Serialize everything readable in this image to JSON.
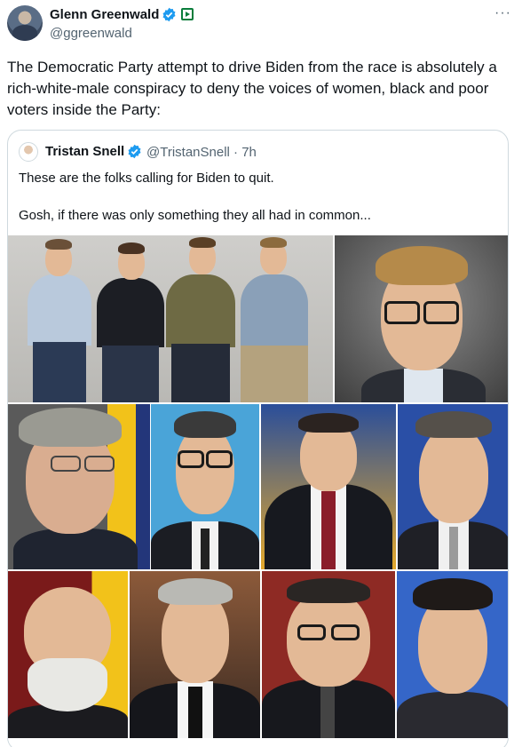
{
  "post": {
    "author": "Glenn Greenwald",
    "handle": "@ggreenwald",
    "more": "···",
    "text": "The Democratic Party attempt to drive Biden from the race is absolutely a rich-white-male conspiracy to deny the voices of women, black and poor voters inside the Party:"
  },
  "quote": {
    "author": "Tristan Snell",
    "handle": "@TristanSnell · 7h",
    "line1": "These are the folks calling for Biden to quit.",
    "line2": "Gosh, if there was only something they all had in common..."
  },
  "colors": {
    "verified": "#1d9bf0",
    "border": "#cfd9de",
    "secondary": "#536471"
  }
}
